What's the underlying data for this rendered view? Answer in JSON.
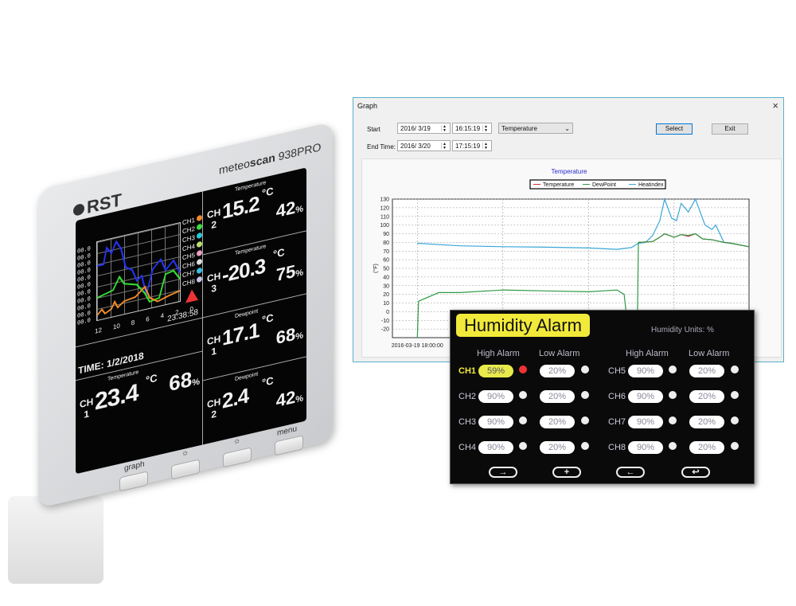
{
  "device": {
    "brand": "RST",
    "model_prefix": "meteo",
    "model_bold": "scan",
    "model_suffix": "938PRO",
    "graph_y_labels": [
      "00.0",
      "00.0",
      "00.0",
      "00.0",
      "00.0",
      "00.0",
      "00.0",
      "00.0",
      "00.0",
      "00.0",
      "00.0"
    ],
    "graph_x_labels": [
      "12",
      "10",
      "8",
      "6",
      "4",
      "2",
      "0"
    ],
    "channels": [
      {
        "name": "CH1",
        "color": "#f08a2a"
      },
      {
        "name": "CH2",
        "color": "#3ddc3d"
      },
      {
        "name": "CH3",
        "color": "#2ac8d8"
      },
      {
        "name": "CH4",
        "color": "#b8e06a"
      },
      {
        "name": "CH5",
        "color": "#e8a0c0"
      },
      {
        "name": "CH6",
        "color": "#dddddd"
      },
      {
        "name": "CH7",
        "color": "#35c0e0"
      },
      {
        "name": "CH8",
        "color": "#c8c0e8"
      }
    ],
    "time_label": "TIME:",
    "date": "1/2/2018",
    "clock": "23:38:58",
    "bottom_reading": {
      "label": "Temperature",
      "ch": "CH",
      "num": "1",
      "value": "23.4",
      "unit": "°C",
      "hum": "68",
      "pct": "%"
    },
    "readings": [
      {
        "label": "Temperature",
        "ch": "CH",
        "num": "2",
        "value": "15.2",
        "unit": "°C",
        "hum": "42",
        "pct": "%"
      },
      {
        "label": "Temperature",
        "ch": "CH",
        "num": "3",
        "value": "-20.3",
        "unit": "°C",
        "hum": "75",
        "pct": "%"
      },
      {
        "label": "Dewpoint",
        "ch": "CH",
        "num": "1",
        "value": "17.1",
        "unit": "°C",
        "hum": "68",
        "pct": "%"
      },
      {
        "label": "Dewpoint",
        "ch": "CH",
        "num": "2",
        "value": "2.4",
        "unit": "°C",
        "hum": "42",
        "pct": "%"
      }
    ],
    "buttons": {
      "graph": "graph",
      "bright_up": "☼",
      "bright_down": "☼",
      "menu": "menu"
    }
  },
  "graph_window": {
    "title": "Graph",
    "close": "×",
    "start_label": "Start",
    "start_date": "2016/ 3/19",
    "start_time": "16:15:19",
    "end_label": "End Time:",
    "end_date": "2016/ 3/20",
    "end_time": "17:15:19",
    "measure_select": "Temperature",
    "select_button": "Select",
    "exit_button": "Exit"
  },
  "chart_data": {
    "type": "line",
    "title": "Temperature",
    "ylabel": "(°F)",
    "xtick_labels": [
      "2016-03-19 18:00:00"
    ],
    "xlim": [
      "2016-03-19 16:15:19",
      "2016-03-20 17:15:19"
    ],
    "ylim": [
      -30,
      130
    ],
    "yticks": [
      -20,
      -10,
      0,
      10,
      20,
      30,
      40,
      50,
      60,
      70,
      80,
      90,
      100,
      110,
      120,
      130
    ],
    "grid": true,
    "legend_position": "top-center",
    "series": [
      {
        "name": "Temperature",
        "color": "#d03030",
        "points": [
          [
            "2016-03-20 09:30",
            80
          ],
          [
            "2016-03-20 10:30",
            81
          ],
          [
            "2016-03-20 11:00",
            86
          ],
          [
            "2016-03-20 11:20",
            90
          ],
          [
            "2016-03-20 12:00",
            86
          ],
          [
            "2016-03-20 12:30",
            89
          ],
          [
            "2016-03-20 13:00",
            87
          ],
          [
            "2016-03-20 13:30",
            90
          ],
          [
            "2016-03-20 14:00",
            84
          ],
          [
            "2016-03-20 14:40",
            83
          ],
          [
            "2016-03-20 15:30",
            80
          ],
          [
            "2016-03-20 16:00",
            79
          ],
          [
            "2016-03-20 17:15",
            75
          ]
        ]
      },
      {
        "name": "DewPoint",
        "color": "#2f9a45",
        "points": [
          [
            "2016-03-19 18:00",
            -30
          ],
          [
            "2016-03-19 18:05",
            12
          ],
          [
            "2016-03-19 19:30",
            22
          ],
          [
            "2016-03-19 21:00",
            22
          ],
          [
            "2016-03-20 00:00",
            25
          ],
          [
            "2016-03-20 03:00",
            24
          ],
          [
            "2016-03-20 06:00",
            23
          ],
          [
            "2016-03-20 08:00",
            25
          ],
          [
            "2016-03-20 08:30",
            20
          ],
          [
            "2016-03-20 08:50",
            -30
          ],
          null,
          [
            "2016-03-20 09:25",
            -30
          ],
          [
            "2016-03-20 09:30",
            80
          ],
          [
            "2016-03-20 10:30",
            81
          ],
          [
            "2016-03-20 11:00",
            86
          ],
          [
            "2016-03-20 11:20",
            90
          ],
          [
            "2016-03-20 12:00",
            86
          ],
          [
            "2016-03-20 12:30",
            89
          ],
          [
            "2016-03-20 13:00",
            88
          ],
          [
            "2016-03-20 13:30",
            90
          ],
          [
            "2016-03-20 14:00",
            84
          ],
          [
            "2016-03-20 14:40",
            83
          ],
          [
            "2016-03-20 15:30",
            80
          ],
          [
            "2016-03-20 16:00",
            79
          ],
          [
            "2016-03-20 17:15",
            75
          ]
        ]
      },
      {
        "name": "Heatindex",
        "color": "#3aa6d8",
        "points": [
          [
            "2016-03-19 18:00",
            79
          ],
          [
            "2016-03-19 21:00",
            76
          ],
          [
            "2016-03-20 00:00",
            75
          ],
          [
            "2016-03-20 03:00",
            74.5
          ],
          [
            "2016-03-20 06:00",
            73.5
          ],
          [
            "2016-03-20 08:00",
            72
          ],
          [
            "2016-03-20 09:00",
            74
          ],
          [
            "2016-03-20 09:30",
            79
          ],
          [
            "2016-03-20 10:00",
            80
          ],
          [
            "2016-03-20 10:30",
            88
          ],
          [
            "2016-03-20 11:00",
            105
          ],
          [
            "2016-03-20 11:20",
            130
          ],
          [
            "2016-03-20 11:50",
            108
          ],
          [
            "2016-03-20 12:10",
            105
          ],
          [
            "2016-03-20 12:30",
            125
          ],
          [
            "2016-03-20 13:00",
            115
          ],
          [
            "2016-03-20 13:30",
            130
          ],
          [
            "2016-03-20 14:10",
            100
          ],
          [
            "2016-03-20 14:40",
            95
          ],
          [
            "2016-03-20 14:55",
            100
          ],
          [
            "2016-03-20 15:30",
            80
          ],
          [
            "2016-03-20 16:00",
            79
          ],
          [
            "2016-03-20 17:15",
            75
          ]
        ]
      }
    ]
  },
  "alarm": {
    "title": "Humidity Alarm",
    "units": "Humidity Units: %",
    "high_header": "High Alarm",
    "low_header": "Low Alarm",
    "rows": [
      {
        "ch": "CH1",
        "high": "59%",
        "low": "20%"
      },
      {
        "ch": "CH2",
        "high": "90%",
        "low": "20%"
      },
      {
        "ch": "CH3",
        "high": "90%",
        "low": "20%"
      },
      {
        "ch": "CH4",
        "high": "90%",
        "low": "20%"
      },
      {
        "ch": "CH5",
        "high": "90%",
        "low": "20%"
      },
      {
        "ch": "CH6",
        "high": "90%",
        "low": "20%"
      },
      {
        "ch": "CH7",
        "high": "90%",
        "low": "20%"
      },
      {
        "ch": "CH8",
        "high": "90%",
        "low": "20%"
      }
    ],
    "active_color": "#f2ea3a",
    "nav": {
      "next": "→",
      "add": "+",
      "prev": "←",
      "back": "↩"
    }
  }
}
